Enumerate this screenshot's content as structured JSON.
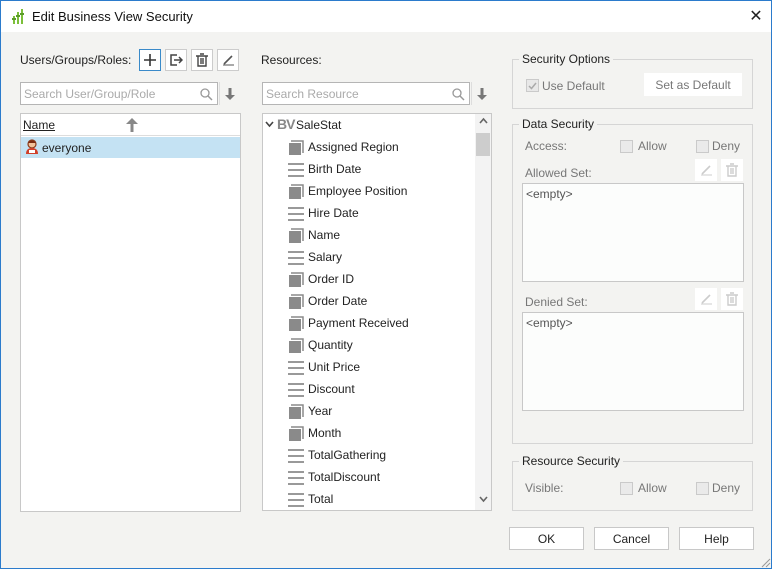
{
  "window": {
    "title": "Edit Business View Security",
    "close_icon": "close-icon"
  },
  "users": {
    "label": "Users/Groups/Roles:",
    "toolbar": [
      {
        "name": "add-button",
        "icon": "plus-icon"
      },
      {
        "name": "import-button",
        "icon": "import-icon"
      },
      {
        "name": "delete-button",
        "icon": "trash-icon"
      },
      {
        "name": "edit-button",
        "icon": "pencil-icon"
      }
    ],
    "search_placeholder": "Search User/Group/Role",
    "search_value": "",
    "column_header": "Name",
    "rows": [
      {
        "name": "everyone",
        "icon": "user-avatar-icon",
        "selected": true
      }
    ]
  },
  "resources": {
    "label": "Resources:",
    "search_placeholder": "Search Resource",
    "search_value": "",
    "root": {
      "name": "SaleStat",
      "badge": "BV",
      "expanded": true
    },
    "items": [
      {
        "name": "Assigned Region",
        "type": "dimension"
      },
      {
        "name": "Birth Date",
        "type": "detail"
      },
      {
        "name": "Employee Position",
        "type": "dimension"
      },
      {
        "name": "Hire Date",
        "type": "detail"
      },
      {
        "name": "Name",
        "type": "dimension"
      },
      {
        "name": "Salary",
        "type": "detail"
      },
      {
        "name": "Order ID",
        "type": "dimension"
      },
      {
        "name": "Order Date",
        "type": "dimension"
      },
      {
        "name": "Payment Received",
        "type": "dimension"
      },
      {
        "name": "Quantity",
        "type": "dimension"
      },
      {
        "name": "Unit Price",
        "type": "detail"
      },
      {
        "name": "Discount",
        "type": "detail"
      },
      {
        "name": "Year",
        "type": "dimension"
      },
      {
        "name": "Month",
        "type": "dimension"
      },
      {
        "name": "TotalGathering",
        "type": "detail"
      },
      {
        "name": "TotalDiscount",
        "type": "detail"
      },
      {
        "name": "Total",
        "type": "detail"
      }
    ]
  },
  "security_options": {
    "title": "Security Options",
    "use_default_label": "Use Default",
    "use_default_checked": true,
    "set_default_label": "Set as Default"
  },
  "data_security": {
    "title": "Data Security",
    "access_label": "Access:",
    "allow_label": "Allow",
    "deny_label": "Deny",
    "allowed_set_label": "Allowed Set:",
    "allowed_set_value": "<empty>",
    "denied_set_label": "Denied Set:",
    "denied_set_value": "<empty>"
  },
  "resource_security": {
    "title": "Resource Security",
    "visible_label": "Visible:",
    "allow_label": "Allow",
    "deny_label": "Deny"
  },
  "footer": {
    "ok": "OK",
    "cancel": "Cancel",
    "help": "Help"
  }
}
